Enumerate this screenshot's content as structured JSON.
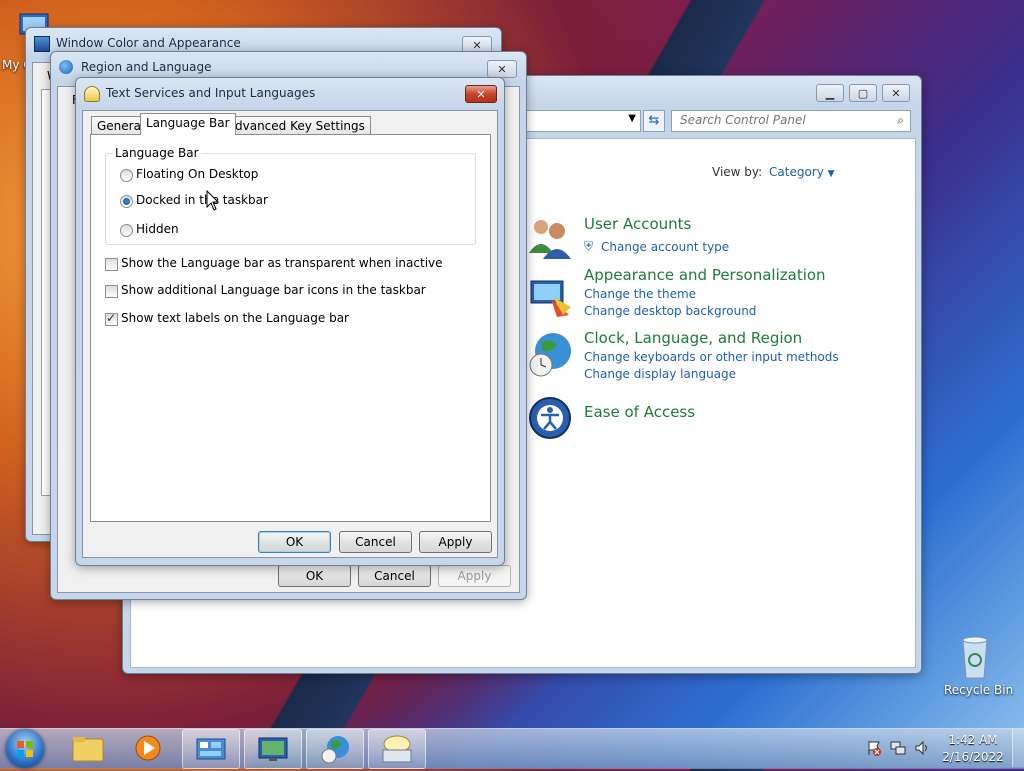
{
  "desktop": {
    "my_computer_label": "My C",
    "recycle_bin_label": "Recycle Bin"
  },
  "window_color": {
    "title": "Window Color and Appearance",
    "fragment": "W"
  },
  "region_language": {
    "title": "Region and Language",
    "tab_fragment": "F",
    "ok": "OK",
    "cancel": "Cancel",
    "apply": "Apply"
  },
  "control_panel": {
    "search_placeholder": "Search Control Panel",
    "view_by_label": "View by:",
    "view_by_value": "Category",
    "categories": [
      {
        "title": "User Accounts",
        "links": [
          "Change account type"
        ]
      },
      {
        "title": "Appearance and Personalization",
        "links": [
          "Change the theme",
          "Change desktop background"
        ]
      },
      {
        "title": "Clock, Language, and Region",
        "links": [
          "Change keyboards or other input methods",
          "Change display language"
        ]
      },
      {
        "title": "Ease of Access",
        "links": []
      }
    ]
  },
  "dialog": {
    "title": "Text Services and Input Languages",
    "tabs": [
      "General",
      "Language Bar",
      "Advanced Key Settings"
    ],
    "active_tab": "Language Bar",
    "group_label": "Language Bar",
    "radios": [
      {
        "label": "Floating On Desktop",
        "checked": false
      },
      {
        "label": "Docked in the taskbar",
        "checked": true
      },
      {
        "label": "Hidden",
        "checked": false
      }
    ],
    "checkboxes": [
      {
        "label": "Show the Language bar as transparent when inactive",
        "checked": false
      },
      {
        "label": "Show additional Language bar icons in the taskbar",
        "checked": false
      },
      {
        "label": "Show text labels on the Language bar",
        "checked": true
      }
    ],
    "ok": "OK",
    "cancel": "Cancel",
    "apply": "Apply"
  },
  "taskbar": {
    "time": "1:42 AM",
    "date": "2/16/2022"
  },
  "colors": {
    "link": "#1e5fb4",
    "category_heading": "#1c7c38"
  }
}
